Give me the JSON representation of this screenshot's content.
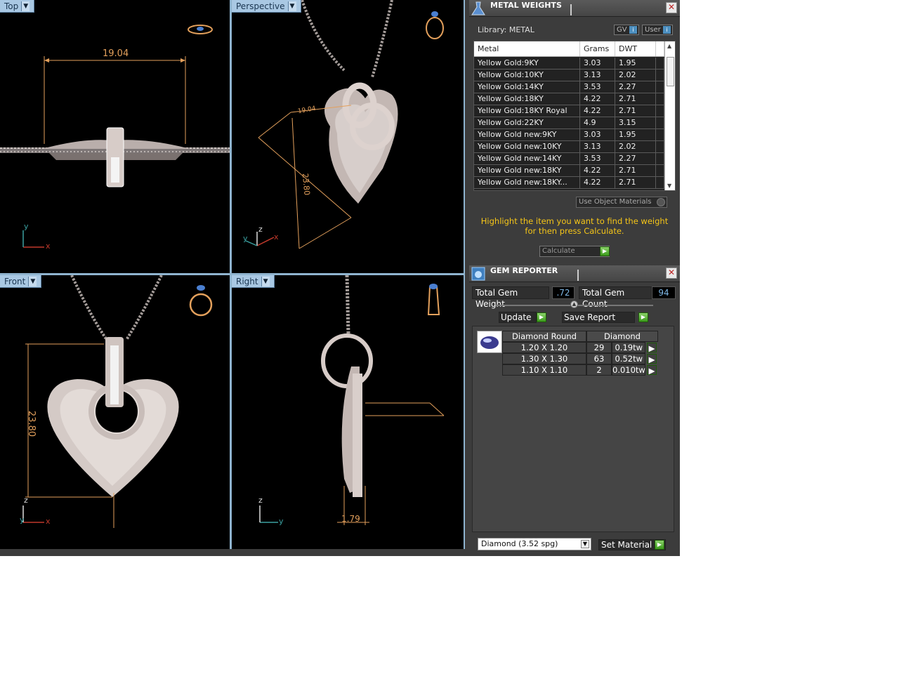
{
  "viewports": {
    "top": {
      "label": "Top",
      "dimension": "19.04",
      "axes": [
        "y",
        "x"
      ]
    },
    "perspective": {
      "label": "Perspective",
      "dimension_a": "19.04",
      "dimension_b": "23.80",
      "axes": [
        "z",
        "y",
        "x"
      ]
    },
    "front": {
      "label": "Front",
      "dimension": "23.80",
      "axes": [
        "z",
        "y",
        "x"
      ]
    },
    "right": {
      "label": "Right",
      "dimension": "1.79",
      "axes": [
        "z",
        "y"
      ]
    }
  },
  "metal_weights": {
    "title": "METAL WEIGHTS",
    "library_label": "Library: METAL",
    "toggle_gv": "GV",
    "toggle_user": "User",
    "columns": [
      "Metal",
      "Grams",
      "DWT"
    ],
    "rows": [
      {
        "metal": "Yellow Gold:9KY",
        "grams": "3.03",
        "dwt": "1.95"
      },
      {
        "metal": "Yellow Gold:10KY",
        "grams": "3.13",
        "dwt": "2.02"
      },
      {
        "metal": "Yellow Gold:14KY",
        "grams": "3.53",
        "dwt": "2.27"
      },
      {
        "metal": "Yellow Gold:18KY",
        "grams": "4.22",
        "dwt": "2.71"
      },
      {
        "metal": "Yellow Gold:18KY Royal",
        "grams": "4.22",
        "dwt": "2.71"
      },
      {
        "metal": "Yellow Gold:22KY",
        "grams": "4.9",
        "dwt": "3.15"
      },
      {
        "metal": "Yellow Gold new:9KY",
        "grams": "3.03",
        "dwt": "1.95"
      },
      {
        "metal": "Yellow Gold new:10KY",
        "grams": "3.13",
        "dwt": "2.02"
      },
      {
        "metal": "Yellow Gold new:14KY",
        "grams": "3.53",
        "dwt": "2.27"
      },
      {
        "metal": "Yellow Gold new:18KY",
        "grams": "4.22",
        "dwt": "2.71"
      },
      {
        "metal": "Yellow Gold new:18KY...",
        "grams": "4.22",
        "dwt": "2.71"
      }
    ],
    "use_object_materials": "Use Object Materials",
    "hint": "Highlight the item you want to find the weight for then press Calculate.",
    "calculate": "Calculate"
  },
  "gem_reporter": {
    "title": "GEM REPORTER",
    "total_weight_label": "Total Gem Weight",
    "total_weight_value": ".72",
    "total_count_label": "Total Gem Count",
    "total_count_value": "94",
    "update": "Update",
    "save_report": "Save Report",
    "table_header": [
      "Diamond Round",
      "Diamond"
    ],
    "rows": [
      {
        "size": "1.20 X 1.20",
        "count": "29",
        "weight": "0.19tw"
      },
      {
        "size": "1.30 X 1.30",
        "count": "63",
        "weight": "0.52tw"
      },
      {
        "size": "1.10 X 1.10",
        "count": "2",
        "weight": "0.010tw"
      }
    ],
    "material_select": "Diamond    (3.52 spg)",
    "set_material": "Set Material"
  }
}
